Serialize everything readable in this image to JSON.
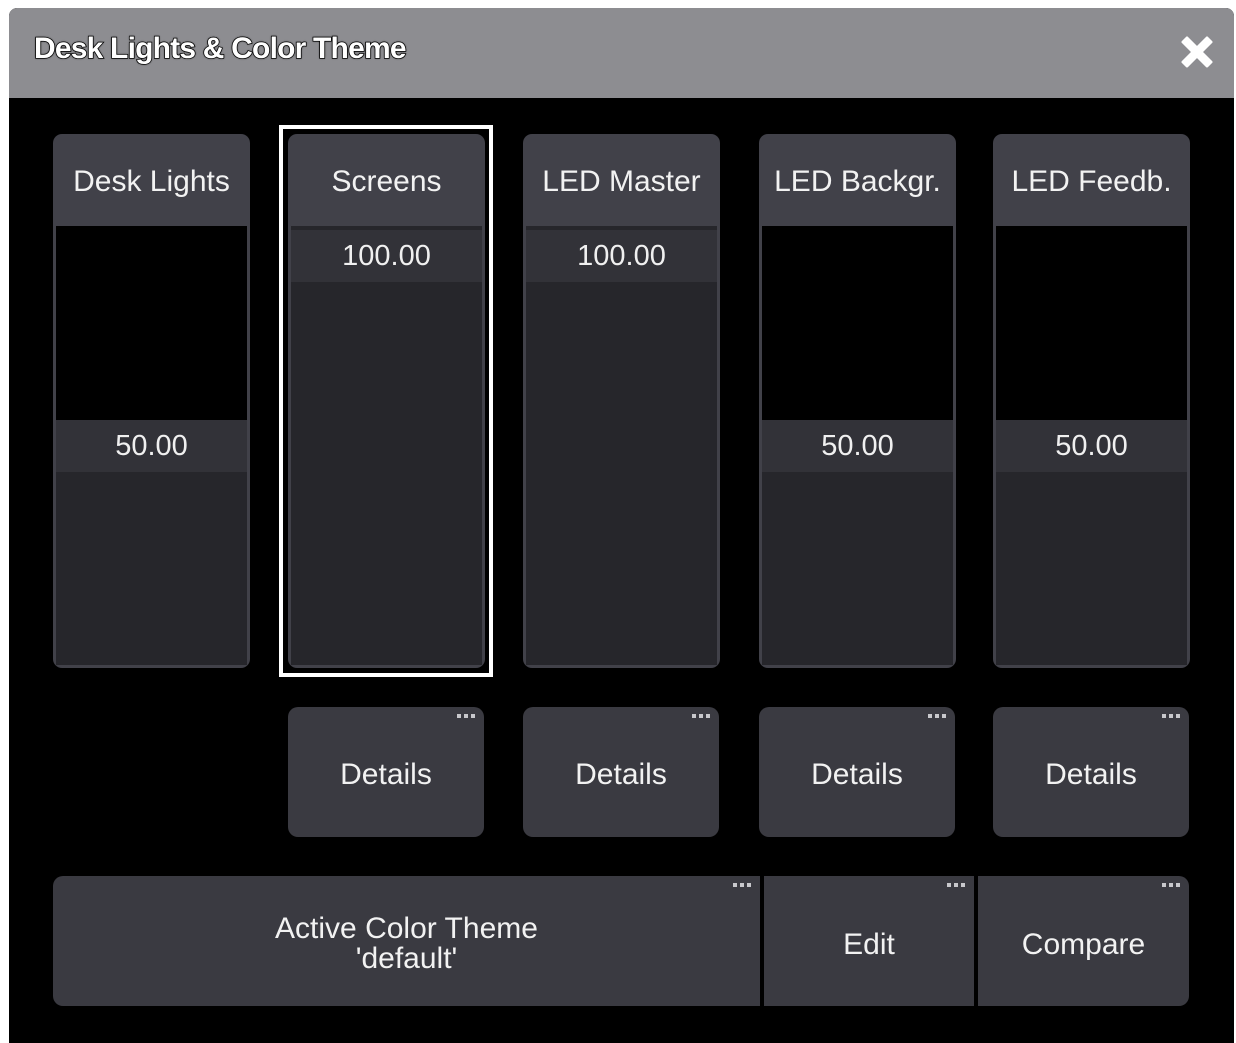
{
  "window": {
    "title": "Desk Lights & Color Theme",
    "close_icon": "close-x-icon"
  },
  "faders": [
    {
      "label": "Desk Lights",
      "value": "50.00",
      "level": 0.5
    },
    {
      "label": "Screens",
      "value": "100.00",
      "level": 1.0,
      "selected": true
    },
    {
      "label": "LED Master",
      "value": "100.00",
      "level": 1.0
    },
    {
      "label": "LED Backgr.",
      "value": "50.00",
      "level": 0.5
    },
    {
      "label": "LED Feedb.",
      "value": "50.00",
      "level": 0.5
    }
  ],
  "details_buttons": [
    "Details",
    "Details",
    "Details",
    "Details"
  ],
  "color_theme": {
    "line1": "Active Color Theme",
    "line2": "'default'",
    "edit_label": "Edit",
    "compare_label": "Compare"
  },
  "colors": {
    "titlebar": "#8d8d91",
    "background": "#000000",
    "button": "#3a3a41",
    "fader_fill": "#26262b",
    "selection": "#ffffff"
  },
  "icons": {
    "more": "more-dots-icon"
  }
}
